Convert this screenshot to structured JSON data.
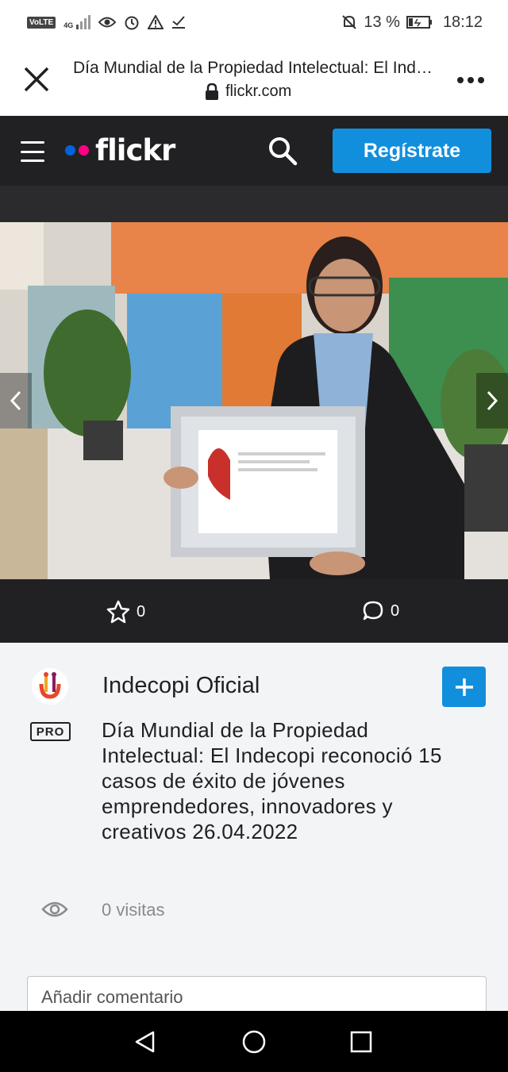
{
  "status_bar": {
    "network": "VoLTE",
    "signal_type": "4G",
    "battery_percent": "13 %",
    "time": "18:12",
    "icons": [
      "volte-icon",
      "signal-icon",
      "eye-icon",
      "alarm-icon",
      "warning-icon",
      "download-check-icon",
      "mute-icon",
      "battery-icon"
    ]
  },
  "browser": {
    "page_title": "Día Mundial de la Propiedad Intelectual: El Indecopi reconoció 15 casos de éxito de jóvenes emprendedores, innovadores y creativos 26.04.2022",
    "domain": "flickr.com"
  },
  "nav": {
    "logo_text": "flickr",
    "signup_label": "Regístrate",
    "colors": {
      "blue_dot": "#0063dc",
      "pink_dot": "#ff0084",
      "accent": "#128fdc"
    }
  },
  "photo": {
    "description_icons": [
      "prev-arrow-icon",
      "next-arrow-icon"
    ]
  },
  "photo_bar": {
    "favorites_count": "0",
    "comments_count": "0"
  },
  "info": {
    "owner_name": "Indecopi Oficial",
    "pro_badge": "PRO",
    "photo_title": "Día Mundial de la Propiedad Intelectual: El Indecopi reconoció 15 casos de éxito de jóvenes emprendedores, innovadores y creativos 26.04.2022",
    "views": "0 visitas",
    "comment_placeholder": "Añadir comentario"
  }
}
